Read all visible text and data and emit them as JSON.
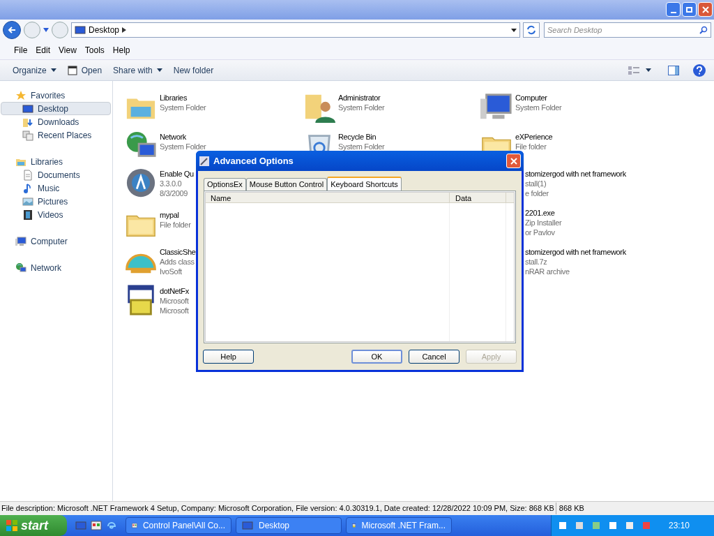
{
  "address": {
    "location": "Desktop",
    "search_placeholder": "Search Desktop"
  },
  "menu": [
    "File",
    "Edit",
    "View",
    "Tools",
    "Help"
  ],
  "toolbar": [
    {
      "label": "Organize",
      "kind": "menu"
    },
    {
      "label": "Open",
      "kind": "icon"
    },
    {
      "label": "Share with",
      "kind": "menu"
    },
    {
      "label": "New folder",
      "kind": "plain"
    }
  ],
  "sidebar": [
    {
      "label": "Favorites",
      "kind": "star",
      "selected": false,
      "children": [
        {
          "label": "Desktop",
          "kind": "desktop",
          "selected": true
        },
        {
          "label": "Downloads",
          "kind": "download",
          "selected": false
        },
        {
          "label": "Recent Places",
          "kind": "recent",
          "selected": false
        }
      ]
    },
    {
      "label": "Libraries",
      "kind": "library",
      "selected": false,
      "children": [
        {
          "label": "Documents",
          "kind": "document",
          "selected": false
        },
        {
          "label": "Music",
          "kind": "music",
          "selected": false
        },
        {
          "label": "Pictures",
          "kind": "pictures",
          "selected": false
        },
        {
          "label": "Videos",
          "kind": "videos",
          "selected": false
        }
      ]
    },
    {
      "label": "Computer",
      "kind": "computer",
      "selected": false
    },
    {
      "label": "Network",
      "kind": "network",
      "selected": false
    }
  ],
  "files": [
    {
      "kind": "library",
      "lines": [
        "Libraries",
        "System Folder"
      ]
    },
    {
      "kind": "user",
      "lines": [
        "Administrator",
        "System Folder"
      ]
    },
    {
      "kind": "computer",
      "lines": [
        "Computer",
        "System Folder"
      ]
    },
    {
      "kind": "network",
      "lines": [
        "Network",
        "System Folder"
      ]
    },
    {
      "kind": "recycle",
      "lines": [
        "Recycle Bin",
        "System Folder"
      ]
    },
    {
      "kind": "folder",
      "lines": [
        "eXPerience",
        "File folder"
      ]
    },
    {
      "kind": "app",
      "lines": [
        "Enable Qu",
        "3.3.0.0",
        "8/3/2009"
      ]
    },
    {
      "kind": "covered",
      "lines": [
        "stomizergod with net framework",
        "stall(1)",
        "e folder"
      ]
    },
    {
      "kind": "folder",
      "lines": [
        "mypal",
        "File folder"
      ]
    },
    {
      "kind": "covered",
      "lines": [
        "2201.exe",
        "Zip Installer",
        "or Pavlov"
      ]
    },
    {
      "kind": "shell",
      "lines": [
        "ClassicShe",
        "Adds class",
        "IvoSoft"
      ]
    },
    {
      "kind": "covered",
      "lines": [
        "stomizergod with net framework",
        "stall.7z",
        "nRAR archive"
      ]
    },
    {
      "kind": "installer",
      "lines": [
        "dotNetFx",
        "Microsoft",
        "Microsoft"
      ]
    }
  ],
  "dialog": {
    "title": "Advanced Options",
    "tabs": [
      {
        "label": "OptionsEx",
        "selected": false
      },
      {
        "label": "Mouse Button Control",
        "selected": false
      },
      {
        "label": "Keyboard Shortcuts",
        "selected": true
      }
    ],
    "columns": [
      "Name",
      "Data"
    ],
    "buttons": [
      {
        "label": "Help",
        "default": false,
        "disabled": false
      },
      {
        "label": "OK",
        "default": true,
        "disabled": false
      },
      {
        "label": "Cancel",
        "default": false,
        "disabled": false
      },
      {
        "label": "Apply",
        "default": false,
        "disabled": true
      }
    ]
  },
  "status_bar": [
    "File description: Microsoft .NET Framework 4 Setup, Company: Microsoft Corporation, File version: 4.0.30319.1, Date created: 12/28/2022 10:09 PM, Size: 868 KB",
    "868 KB"
  ],
  "taskbar": {
    "start": "start",
    "tasks": [
      {
        "label": "Control Panel\\All Co...",
        "kind": "panel"
      },
      {
        "label": "Desktop",
        "kind": "desktop"
      },
      {
        "label": "Microsoft .NET Fram...",
        "kind": "installer"
      }
    ],
    "clock": "23:10"
  }
}
